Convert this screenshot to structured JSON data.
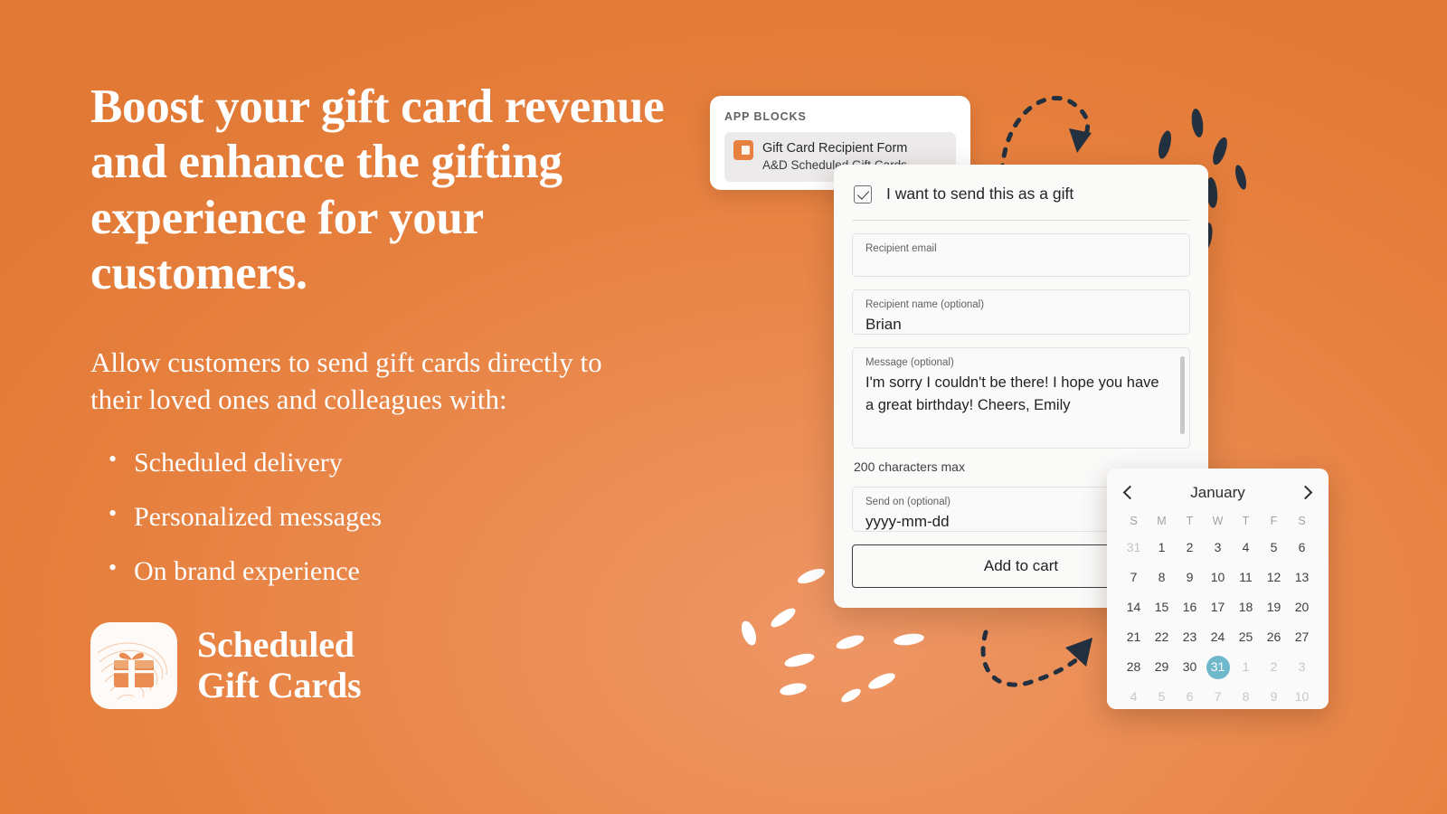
{
  "theme": {
    "background_orange": "#e8803f",
    "background_orange_light": "#ee9665",
    "accent_navy": "#22303f",
    "selected_day_teal": "#6fb8cb",
    "text_white": "#ffffff"
  },
  "hero": {
    "headline": "Boost your gift card revenue and enhance the gifting experience for your customers.",
    "subcopy": "Allow customers to send gift cards directly to their loved ones and colleagues with:",
    "bullets": [
      "Scheduled delivery",
      "Personalized messages",
      "On brand experience"
    ]
  },
  "logo": {
    "line1": "Scheduled",
    "line2": "Gift Cards",
    "icon": "gift-card-icon"
  },
  "app_blocks": {
    "title": "APP BLOCKS",
    "item": {
      "name": "Gift Card Recipient Form",
      "subtitle": "A&D Scheduled Gift Cards",
      "icon": "gift-card-block-icon"
    }
  },
  "gift_form": {
    "gift_checkbox_label": "I want to send this as a gift",
    "gift_checkbox_checked": true,
    "fields": [
      {
        "key": "recipient_email",
        "label": "Recipient email",
        "value": ""
      },
      {
        "key": "recipient_name",
        "label": "Recipient name (optional)",
        "value": "Brian"
      },
      {
        "key": "message",
        "label": "Message (optional)",
        "value": "I'm sorry I couldn't be there! I hope you have a great birthday!  Cheers, Emily"
      },
      {
        "key": "send_on",
        "label": "Send on (optional)",
        "value": "yyyy-mm-dd"
      }
    ],
    "char_limit_note": "200 characters max",
    "submit_label": "Add to cart"
  },
  "calendar": {
    "month": "January",
    "prev_label": "‹",
    "next_label": "›",
    "weekdays": [
      "S",
      "M",
      "T",
      "W",
      "T",
      "F",
      "S"
    ],
    "selected_day": 31,
    "days": [
      {
        "n": "31",
        "muted": true
      },
      {
        "n": "1"
      },
      {
        "n": "2"
      },
      {
        "n": "3"
      },
      {
        "n": "4"
      },
      {
        "n": "5"
      },
      {
        "n": "6"
      },
      {
        "n": "7"
      },
      {
        "n": "8"
      },
      {
        "n": "9"
      },
      {
        "n": "10"
      },
      {
        "n": "11"
      },
      {
        "n": "12"
      },
      {
        "n": "13"
      },
      {
        "n": "14"
      },
      {
        "n": "15"
      },
      {
        "n": "16"
      },
      {
        "n": "17"
      },
      {
        "n": "18"
      },
      {
        "n": "19"
      },
      {
        "n": "20"
      },
      {
        "n": "21"
      },
      {
        "n": "22"
      },
      {
        "n": "23"
      },
      {
        "n": "24"
      },
      {
        "n": "25"
      },
      {
        "n": "26"
      },
      {
        "n": "27"
      },
      {
        "n": "28"
      },
      {
        "n": "29"
      },
      {
        "n": "30"
      },
      {
        "n": "31",
        "selected": true
      },
      {
        "n": "1",
        "muted": true
      },
      {
        "n": "2",
        "muted": true
      },
      {
        "n": "3",
        "muted": true
      },
      {
        "n": "4",
        "muted": true
      },
      {
        "n": "5",
        "muted": true
      },
      {
        "n": "6",
        "muted": true
      },
      {
        "n": "7",
        "muted": true
      },
      {
        "n": "8",
        "muted": true
      },
      {
        "n": "9",
        "muted": true
      },
      {
        "n": "10",
        "muted": true
      }
    ]
  },
  "decorations": {
    "arrow_top": "dashed-curved-arrow-down-right",
    "arrow_bottom": "dashed-curved-arrow-up-right",
    "confetti_white": "white-ellipse-confetti",
    "confetti_navy": "navy-ellipse-confetti"
  }
}
